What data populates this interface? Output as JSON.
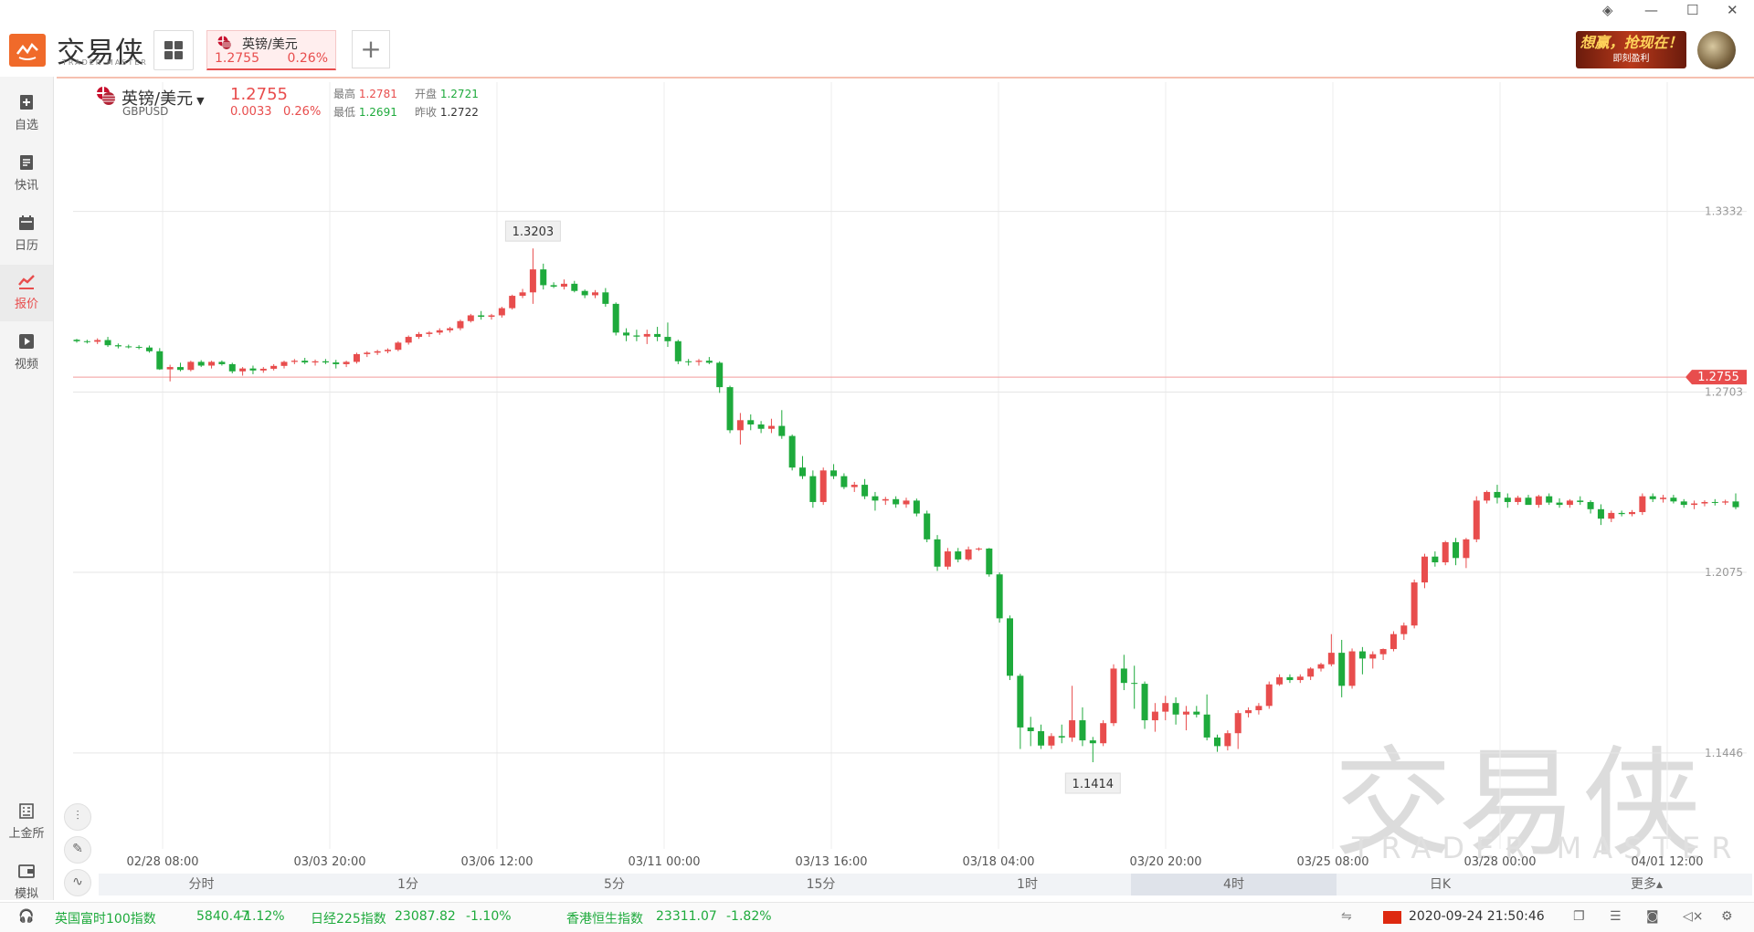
{
  "app": {
    "name": "交易侠",
    "sub": "TRADER MASTER"
  },
  "tab": {
    "name": "英镑/美元",
    "price": "1.2755",
    "change_pct": "0.26%"
  },
  "ad": {
    "text": "想赢，抢现在！",
    "sub": "即刻盈利"
  },
  "sidebar": {
    "items": [
      {
        "label": "自选"
      },
      {
        "label": "快讯"
      },
      {
        "label": "日历"
      },
      {
        "label": "报价"
      },
      {
        "label": "视频"
      }
    ],
    "bottom": [
      {
        "label": "上金所"
      },
      {
        "label": "模拟"
      }
    ]
  },
  "symbol": {
    "name": "英镑/美元",
    "code": "GBPUSD",
    "price": "1.2755",
    "change": "0.0033",
    "change_pct": "0.26%",
    "high_label": "最高",
    "high": "1.2781",
    "open_label": "开盘",
    "open": "1.2721",
    "low_label": "最低",
    "low": "1.2691",
    "prevclose_label": "昨收",
    "prevclose": "1.2722"
  },
  "chart_data": {
    "type": "candlestick",
    "y_ticks": [
      "1.3332",
      "1.2703",
      "1.2075",
      "1.1446"
    ],
    "y_tick_values": [
      1.3332,
      1.2703,
      1.2075,
      1.1446
    ],
    "ylim": [
      1.1112,
      1.3782
    ],
    "current_price": "1.2755",
    "current_value": 1.2755,
    "max_label": "1.3203",
    "max_value": 1.3203,
    "min_label": "1.1414",
    "min_value": 1.1414,
    "x_ticks": [
      "02/28 08:00",
      "03/03 20:00",
      "03/06 12:00",
      "03/11 00:00",
      "03/13 16:00",
      "03/18 04:00",
      "03/20 20:00",
      "03/25 08:00",
      "03/28 00:00",
      "04/01 12:00"
    ],
    "candles": [
      [
        1.2885,
        1.2888,
        1.2875,
        1.288
      ],
      [
        1.288,
        1.2885,
        1.2872,
        1.2878
      ],
      [
        1.2878,
        1.289,
        1.287,
        1.2884
      ],
      [
        1.2884,
        1.2895,
        1.286,
        1.2866
      ],
      [
        1.2866,
        1.2872,
        1.2855,
        1.2862
      ],
      [
        1.2862,
        1.2868,
        1.2855,
        1.286
      ],
      [
        1.286,
        1.2866,
        1.2852,
        1.2858
      ],
      [
        1.2858,
        1.2865,
        1.284,
        1.2845
      ],
      [
        1.2845,
        1.2856,
        1.278,
        1.2782
      ],
      [
        1.2782,
        1.2798,
        1.274,
        1.279
      ],
      [
        1.279,
        1.2805,
        1.2775,
        1.278
      ],
      [
        1.278,
        1.2812,
        1.2775,
        1.2808
      ],
      [
        1.2808,
        1.2814,
        1.279,
        1.2795
      ],
      [
        1.2795,
        1.2812,
        1.2785,
        1.2808
      ],
      [
        1.2808,
        1.2813,
        1.2795,
        1.28
      ],
      [
        1.28,
        1.2805,
        1.2768,
        1.2775
      ],
      [
        1.2775,
        1.279,
        1.276,
        1.2785
      ],
      [
        1.2785,
        1.2795,
        1.2765,
        1.2778
      ],
      [
        1.2778,
        1.279,
        1.277,
        1.2784
      ],
      [
        1.2784,
        1.28,
        1.2778,
        1.2794
      ],
      [
        1.2794,
        1.2812,
        1.2785,
        1.2808
      ],
      [
        1.2808,
        1.2818,
        1.28,
        1.2812
      ],
      [
        1.2812,
        1.2822,
        1.28,
        1.2806
      ],
      [
        1.2806,
        1.2816,
        1.2795,
        1.281
      ],
      [
        1.281,
        1.2818,
        1.28,
        1.2806
      ],
      [
        1.2806,
        1.2815,
        1.2785,
        1.28
      ],
      [
        1.28,
        1.2812,
        1.279,
        1.2808
      ],
      [
        1.2808,
        1.284,
        1.2802,
        1.2835
      ],
      [
        1.2835,
        1.2845,
        1.2825,
        1.284
      ],
      [
        1.284,
        1.285,
        1.2832,
        1.2845
      ],
      [
        1.2845,
        1.2855,
        1.2838,
        1.285
      ],
      [
        1.285,
        1.288,
        1.2845,
        1.2875
      ],
      [
        1.2875,
        1.29,
        1.2868,
        1.2895
      ],
      [
        1.2895,
        1.2912,
        1.2888,
        1.2905
      ],
      [
        1.2905,
        1.2915,
        1.2895,
        1.291
      ],
      [
        1.291,
        1.2925,
        1.2902,
        1.2918
      ],
      [
        1.2918,
        1.293,
        1.291,
        1.2925
      ],
      [
        1.2925,
        1.2955,
        1.2918,
        1.295
      ],
      [
        1.295,
        1.2975,
        1.2945,
        1.297
      ],
      [
        1.297,
        1.2985,
        1.2955,
        1.2965
      ],
      [
        1.2965,
        1.2975,
        1.2955,
        1.297
      ],
      [
        1.297,
        1.3,
        1.2962,
        1.2995
      ],
      [
        1.2995,
        1.3042,
        1.299,
        1.3038
      ],
      [
        1.3038,
        1.3062,
        1.303,
        1.305
      ],
      [
        1.305,
        1.3203,
        1.301,
        1.313
      ],
      [
        1.313,
        1.315,
        1.306,
        1.3075
      ],
      [
        1.3075,
        1.3085,
        1.3065,
        1.307
      ],
      [
        1.307,
        1.3095,
        1.306,
        1.308
      ],
      [
        1.308,
        1.309,
        1.305,
        1.3055
      ],
      [
        1.3055,
        1.306,
        1.303,
        1.304
      ],
      [
        1.304,
        1.3058,
        1.303,
        1.305
      ],
      [
        1.305,
        1.3065,
        1.3,
        1.301
      ],
      [
        1.301,
        1.3015,
        1.29,
        1.291
      ],
      [
        1.291,
        1.2925,
        1.288,
        1.29
      ],
      [
        1.29,
        1.292,
        1.288,
        1.2896
      ],
      [
        1.2896,
        1.292,
        1.287,
        1.2905
      ],
      [
        1.2905,
        1.293,
        1.288,
        1.2895
      ],
      [
        1.2895,
        1.2945,
        1.286,
        1.288
      ],
      [
        1.288,
        1.2885,
        1.28,
        1.281
      ],
      [
        1.281,
        1.2818,
        1.2795,
        1.2808
      ],
      [
        1.2808,
        1.2818,
        1.2795,
        1.2812
      ],
      [
        1.2812,
        1.2825,
        1.28,
        1.2805
      ],
      [
        1.2805,
        1.281,
        1.27,
        1.272
      ],
      [
        1.272,
        1.2725,
        1.256,
        1.257
      ],
      [
        1.257,
        1.263,
        1.252,
        1.2605
      ],
      [
        1.2605,
        1.2625,
        1.257,
        1.259
      ],
      [
        1.259,
        1.2602,
        1.256,
        1.2575
      ],
      [
        1.2575,
        1.261,
        1.256,
        1.2585
      ],
      [
        1.2585,
        1.264,
        1.254,
        1.255
      ],
      [
        1.255,
        1.2555,
        1.243,
        1.244
      ],
      [
        1.244,
        1.248,
        1.24,
        1.241
      ],
      [
        1.241,
        1.243,
        1.23,
        1.232
      ],
      [
        1.232,
        1.244,
        1.231,
        1.243
      ],
      [
        1.243,
        1.2452,
        1.24,
        1.241
      ],
      [
        1.241,
        1.242,
        1.2365,
        1.2372
      ],
      [
        1.2372,
        1.239,
        1.2355,
        1.238
      ],
      [
        1.238,
        1.24,
        1.233,
        1.234
      ],
      [
        1.234,
        1.2355,
        1.229,
        1.2325
      ],
      [
        1.2325,
        1.2338,
        1.231,
        1.233
      ],
      [
        1.233,
        1.234,
        1.23,
        1.2312
      ],
      [
        1.2312,
        1.2335,
        1.23,
        1.2325
      ],
      [
        1.2325,
        1.2332,
        1.227,
        1.228
      ],
      [
        1.228,
        1.229,
        1.218,
        1.219
      ],
      [
        1.219,
        1.2205,
        1.208,
        1.2095
      ],
      [
        1.2095,
        1.216,
        1.2085,
        1.2148
      ],
      [
        1.2148,
        1.216,
        1.211,
        1.212
      ],
      [
        1.212,
        1.2165,
        1.2115,
        1.2155
      ],
      [
        1.2155,
        1.2162,
        1.215,
        1.2158
      ],
      [
        1.2158,
        1.216,
        1.206,
        1.2068
      ],
      [
        1.2068,
        1.2075,
        1.19,
        1.1915
      ],
      [
        1.1915,
        1.1925,
        1.17,
        1.1715
      ],
      [
        1.1715,
        1.1722,
        1.146,
        1.1535
      ],
      [
        1.1535,
        1.1572,
        1.147,
        1.1522
      ],
      [
        1.1522,
        1.1545,
        1.146,
        1.1472
      ],
      [
        1.1472,
        1.1515,
        1.146,
        1.1505
      ],
      [
        1.1505,
        1.1545,
        1.148,
        1.15
      ],
      [
        1.15,
        1.168,
        1.1485,
        1.156
      ],
      [
        1.156,
        1.1605,
        1.147,
        1.149
      ],
      [
        1.149,
        1.1502,
        1.1414,
        1.148
      ],
      [
        1.148,
        1.156,
        1.147,
        1.155
      ],
      [
        1.155,
        1.1755,
        1.154,
        1.174
      ],
      [
        1.174,
        1.1788,
        1.1665,
        1.169
      ],
      [
        1.169,
        1.175,
        1.16,
        1.1687
      ],
      [
        1.1687,
        1.1695,
        1.153,
        1.156
      ],
      [
        1.156,
        1.162,
        1.152,
        1.159
      ],
      [
        1.159,
        1.1645,
        1.156,
        1.162
      ],
      [
        1.162,
        1.164,
        1.1545,
        1.158
      ],
      [
        1.158,
        1.161,
        1.1525,
        1.159
      ],
      [
        1.159,
        1.161,
        1.157,
        1.158
      ],
      [
        1.158,
        1.165,
        1.149,
        1.15
      ],
      [
        1.15,
        1.151,
        1.145,
        1.147
      ],
      [
        1.147,
        1.1525,
        1.1455,
        1.1515
      ],
      [
        1.1515,
        1.1595,
        1.146,
        1.1585
      ],
      [
        1.1585,
        1.1605,
        1.157,
        1.1595
      ],
      [
        1.1595,
        1.162,
        1.158,
        1.161
      ],
      [
        1.161,
        1.1695,
        1.16,
        1.1685
      ],
      [
        1.1685,
        1.172,
        1.168,
        1.171
      ],
      [
        1.171,
        1.172,
        1.169,
        1.17
      ],
      [
        1.17,
        1.172,
        1.169,
        1.1712
      ],
      [
        1.1712,
        1.1745,
        1.17,
        1.174
      ],
      [
        1.174,
        1.176,
        1.173,
        1.1755
      ],
      [
        1.1755,
        1.186,
        1.1748,
        1.1795
      ],
      [
        1.1795,
        1.184,
        1.164,
        1.168
      ],
      [
        1.168,
        1.181,
        1.167,
        1.18
      ],
      [
        1.18,
        1.1815,
        1.172,
        1.1775
      ],
      [
        1.1775,
        1.18,
        1.174,
        1.179
      ],
      [
        1.179,
        1.181,
        1.177,
        1.1808
      ],
      [
        1.1808,
        1.187,
        1.18,
        1.186
      ],
      [
        1.186,
        1.19,
        1.184,
        1.189
      ],
      [
        1.189,
        1.205,
        1.188,
        1.204
      ],
      [
        1.204,
        1.214,
        1.202,
        1.213
      ],
      [
        1.213,
        1.2148,
        1.2095,
        1.211
      ],
      [
        1.211,
        1.2185,
        1.21,
        1.218
      ],
      [
        1.218,
        1.2195,
        1.21,
        1.2125
      ],
      [
        1.2125,
        1.2195,
        1.209,
        1.219
      ],
      [
        1.219,
        1.234,
        1.218,
        1.2325
      ],
      [
        1.2325,
        1.236,
        1.2315,
        1.2355
      ],
      [
        1.2355,
        1.238,
        1.2315,
        1.2335
      ],
      [
        1.2335,
        1.235,
        1.23,
        1.232
      ],
      [
        1.232,
        1.2342,
        1.231,
        1.2335
      ],
      [
        1.2335,
        1.2345,
        1.2325,
        1.231
      ],
      [
        1.231,
        1.2345,
        1.23,
        1.234
      ],
      [
        1.234,
        1.235,
        1.231,
        1.2318
      ],
      [
        1.2318,
        1.2333,
        1.23,
        1.231
      ],
      [
        1.231,
        1.233,
        1.23,
        1.2325
      ],
      [
        1.2325,
        1.234,
        1.231,
        1.232
      ],
      [
        1.232,
        1.2326,
        1.228,
        1.2295
      ],
      [
        1.2295,
        1.2312,
        1.224,
        1.2262
      ],
      [
        1.2262,
        1.229,
        1.225,
        1.2282
      ],
      [
        1.2282,
        1.229,
        1.227,
        1.2278
      ],
      [
        1.2278,
        1.2292,
        1.227,
        1.2285
      ],
      [
        1.2285,
        1.235,
        1.2275,
        1.234
      ],
      [
        1.234,
        1.235,
        1.232,
        1.233
      ],
      [
        1.233,
        1.2345,
        1.2318,
        1.2335
      ],
      [
        1.2335,
        1.2345,
        1.2315,
        1.2322
      ],
      [
        1.2322,
        1.233,
        1.23,
        1.231
      ],
      [
        1.231,
        1.2325,
        1.2295,
        1.2315
      ],
      [
        1.2315,
        1.2326,
        1.2305,
        1.232
      ],
      [
        1.232,
        1.233,
        1.2308,
        1.2318
      ],
      [
        1.2318,
        1.2328,
        1.231,
        1.2322
      ],
      [
        1.2322,
        1.235,
        1.2295,
        1.2302
      ]
    ]
  },
  "timeframes": [
    {
      "label": "分时"
    },
    {
      "label": "1分"
    },
    {
      "label": "5分"
    },
    {
      "label": "15分"
    },
    {
      "label": "1时"
    },
    {
      "label": "4时",
      "active": true
    },
    {
      "label": "日K"
    },
    {
      "label": "更多▴"
    }
  ],
  "statusbar": {
    "items": [
      {
        "name": "英国富时100指数",
        "value": "5840.47",
        "pct": "-1.12%"
      },
      {
        "name": "日经225指数",
        "value": "23087.82",
        "pct": "-1.10%"
      },
      {
        "name": "香港恒生指数",
        "value": "23311.07",
        "pct": "-1.82%"
      }
    ],
    "datetime": "2020-09-24 21:50:46"
  },
  "colors": {
    "up": "#e84d4d",
    "down": "#1eaa3c",
    "accent": "#f06a2a"
  }
}
